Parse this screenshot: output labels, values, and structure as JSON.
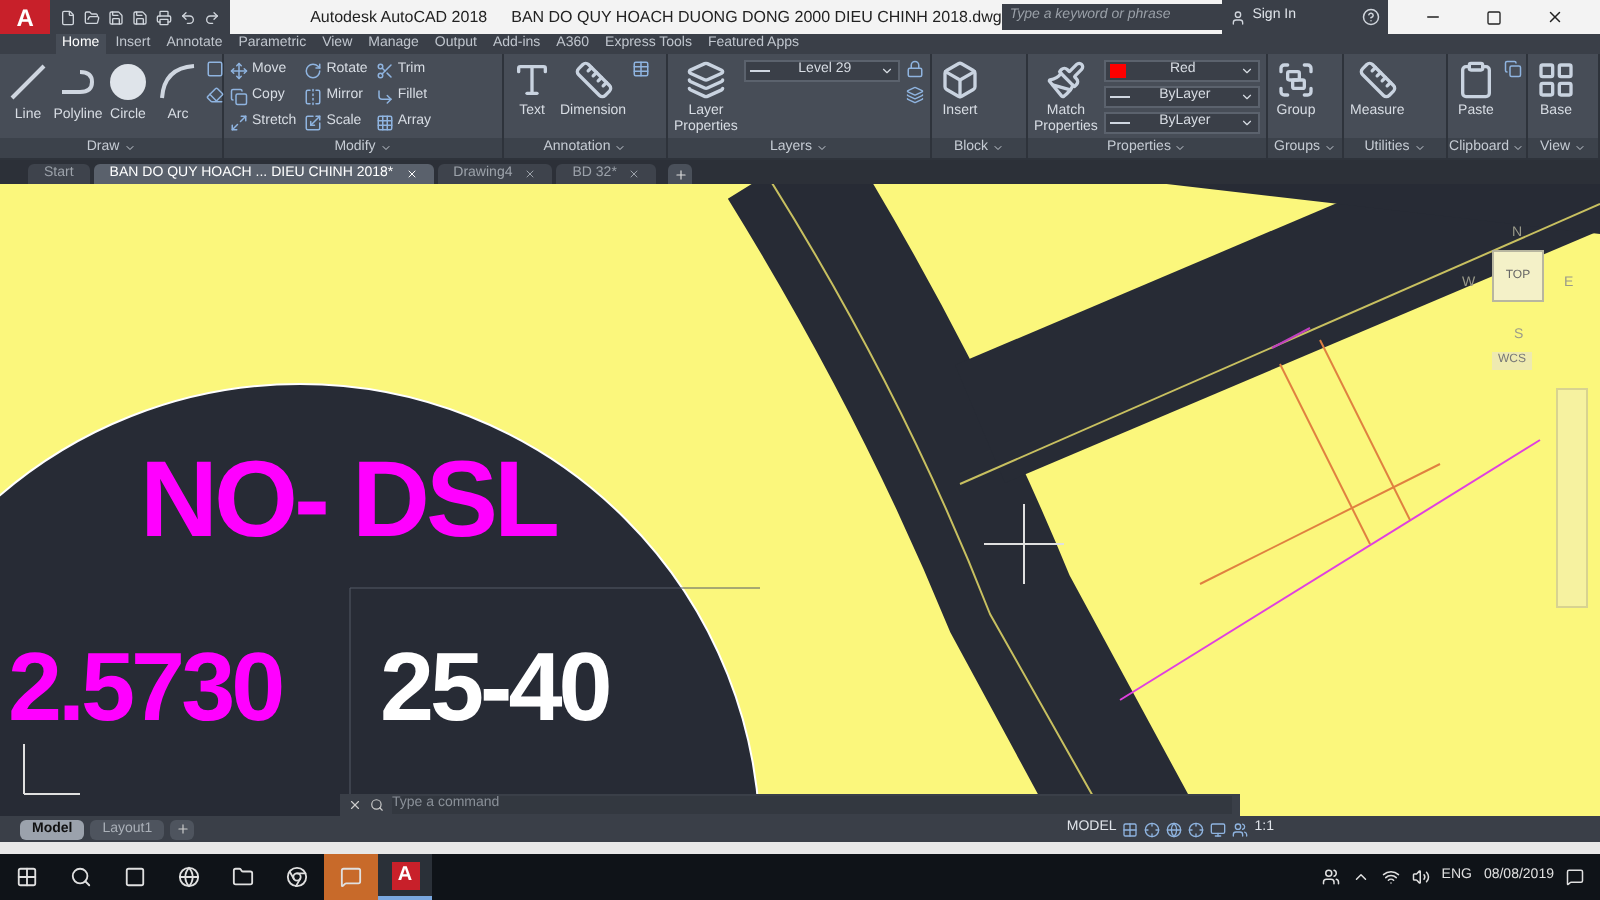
{
  "title_bar": {
    "logo": "A",
    "app_name": "Autodesk AutoCAD 2018",
    "file_name": "BAN DO QUY HOACH DUONG DONG 2000 DIEU CHINH 2018.dwg",
    "search": {
      "placeholder": "Type a keyword or phrase"
    },
    "sign_in": "Sign In"
  },
  "ribbon_tabs": [
    {
      "label": "Home",
      "selected": true
    },
    {
      "label": "Insert",
      "selected": false
    },
    {
      "label": "Annotate",
      "selected": false
    },
    {
      "label": "Parametric",
      "selected": false
    },
    {
      "label": "View",
      "selected": false
    },
    {
      "label": "Manage",
      "selected": false
    },
    {
      "label": "Output",
      "selected": false
    },
    {
      "label": "Add-ins",
      "selected": false
    },
    {
      "label": "A360",
      "selected": false
    },
    {
      "label": "Express Tools",
      "selected": false
    },
    {
      "label": "Featured Apps",
      "selected": false
    }
  ],
  "ribbon_panels": [
    {
      "title": "Draw",
      "tools": [
        {
          "kind": "large",
          "label": "Line"
        },
        {
          "kind": "large",
          "label": "Polyline"
        },
        {
          "kind": "large",
          "label": "Circle"
        },
        {
          "kind": "large",
          "label": "Arc"
        }
      ]
    },
    {
      "title": "Modify",
      "tools": [
        {
          "kind": "small",
          "label": "Move"
        },
        {
          "kind": "small",
          "label": "Copy"
        },
        {
          "kind": "small",
          "label": "Stretch"
        },
        {
          "kind": "small",
          "label": "Rotate"
        },
        {
          "kind": "small",
          "label": "Mirror"
        },
        {
          "kind": "small",
          "label": "Scale"
        },
        {
          "kind": "small",
          "label": "Trim"
        },
        {
          "kind": "small",
          "label": "Fillet"
        },
        {
          "kind": "small",
          "label": "Array"
        }
      ]
    },
    {
      "title": "Annotation",
      "tools": [
        {
          "kind": "large",
          "label": "Text"
        },
        {
          "kind": "large",
          "label": "Dimension"
        }
      ]
    },
    {
      "title": "Layers",
      "tools": [
        {
          "kind": "large",
          "label": "Layer Properties"
        },
        {
          "kind": "select",
          "value": "Level 29"
        }
      ]
    },
    {
      "title": "Block",
      "tools": [
        {
          "kind": "large",
          "label": "Insert"
        }
      ]
    },
    {
      "title": "Properties",
      "tools": [
        {
          "kind": "large",
          "label": "Match Properties"
        },
        {
          "kind": "color_select",
          "value": "Red",
          "color": "#ff0000"
        },
        {
          "kind": "select",
          "value": "ByLayer"
        },
        {
          "kind": "select",
          "value": "ByLayer"
        }
      ]
    },
    {
      "title": "Groups",
      "tools": [
        {
          "kind": "large",
          "label": "Group"
        }
      ]
    },
    {
      "title": "Utilities",
      "tools": [
        {
          "kind": "large",
          "label": "Measure"
        }
      ]
    },
    {
      "title": "Clipboard",
      "tools": [
        {
          "kind": "large",
          "label": "Paste"
        }
      ]
    },
    {
      "title": "View",
      "tools": [
        {
          "kind": "large",
          "label": "Base"
        }
      ]
    }
  ],
  "file_tabs": [
    {
      "label": "Start",
      "selected": false
    },
    {
      "label": "BAN DO QUY HOACH ... DIEU CHINH 2018*",
      "selected": true
    },
    {
      "label": "Drawing4",
      "selected": false
    },
    {
      "label": "BD 32*",
      "selected": false
    }
  ],
  "drawing": {
    "labels": [
      {
        "text": "NO- DSL",
        "color": "#ff00ff"
      },
      {
        "text": "2.5730",
        "color": "#ff00ff"
      },
      {
        "text": "25-40",
        "color": "#ffffff"
      }
    ]
  },
  "view_cube": {
    "north": "N",
    "west": "W",
    "east": "E",
    "south": "S",
    "face": "TOP",
    "ucs": "WCS"
  },
  "command_line": {
    "placeholder": "Type a command"
  },
  "layout_tabs": [
    {
      "label": "Model",
      "selected": true
    },
    {
      "label": "Layout1",
      "selected": false
    }
  ],
  "status_bar": {
    "space": "MODEL",
    "scale": "1:1"
  },
  "taskbar": {
    "app_letter": "A",
    "language": "ENG",
    "date": "08/08/2019"
  }
}
